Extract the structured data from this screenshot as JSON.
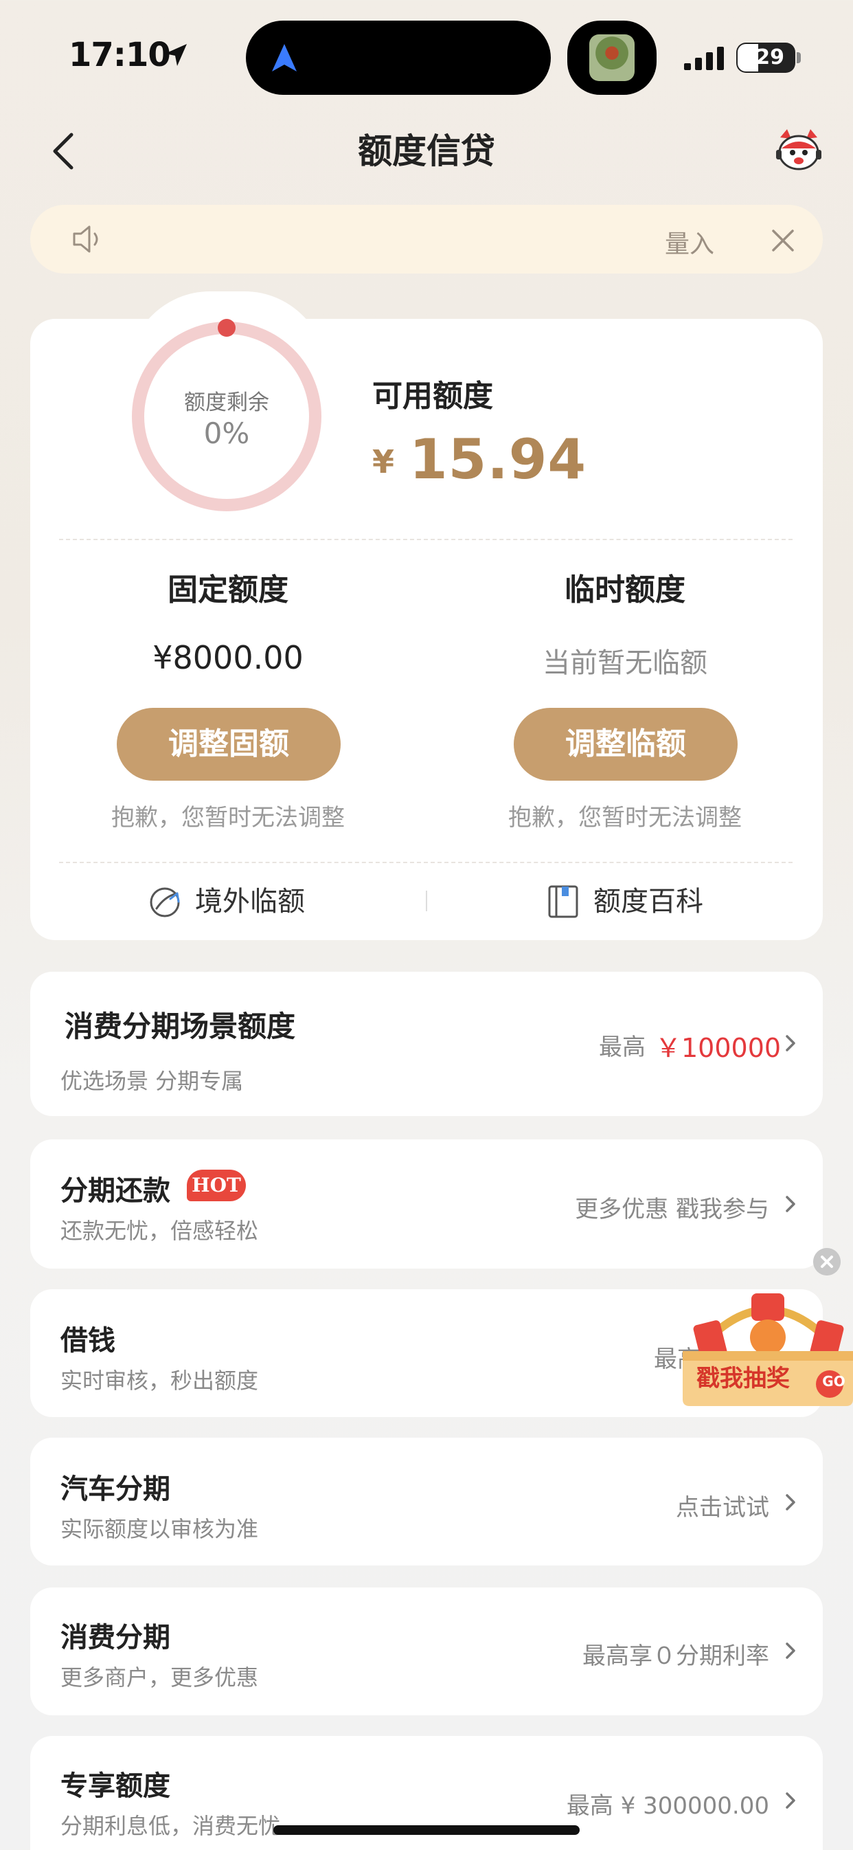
{
  "status_bar": {
    "time": "17:10",
    "battery": "29"
  },
  "header": {
    "title": "额度信贷"
  },
  "notice": {
    "text": "量入"
  },
  "credit": {
    "ring_label": "额度剩余",
    "ring_percent_text": "0%",
    "ring_percent": 0,
    "available_label": "可用额度",
    "currency": "¥",
    "available_amount": "15.94",
    "fixed": {
      "title": "固定额度",
      "value": "¥8000.00",
      "button": "调整固额",
      "note": "抱歉，您暂时无法调整"
    },
    "temporary": {
      "title": "临时额度",
      "value": "当前暂无临额",
      "button": "调整临额",
      "note": "抱歉，您暂时无法调整"
    },
    "links": {
      "overseas": "境外临额",
      "wiki": "额度百科"
    }
  },
  "scene": {
    "title": "消费分期场景额度",
    "subtitle": "优选场景 分期专属",
    "right_prefix": "最高",
    "right_amount": "￥100000"
  },
  "list": [
    {
      "title": "分期还款",
      "badge": "HOT",
      "subtitle": "还款无忧，倍感轻松",
      "right": "更多优惠 戳我参与"
    },
    {
      "title": "借钱",
      "subtitle": "实时审核，秒出额度",
      "right": "最高"
    },
    {
      "title": "汽车分期",
      "subtitle": "实际额度以审核为准",
      "right": "点击试试"
    },
    {
      "title": "消费分期",
      "subtitle": "更多商户，更多优惠",
      "right": "最高享０分期利率"
    },
    {
      "title": "专享额度",
      "subtitle": "分期利息低，消费无忧",
      "right": "最高 ¥ 300000.00"
    }
  ],
  "float_widget": {
    "text": "戳我抽奖",
    "badge": "GO"
  },
  "colors": {
    "accent": "#c79e6e",
    "amount": "#b08757",
    "red": "#e4393c",
    "ring": "#f3cfcf",
    "ring_dot": "#e0504e"
  }
}
